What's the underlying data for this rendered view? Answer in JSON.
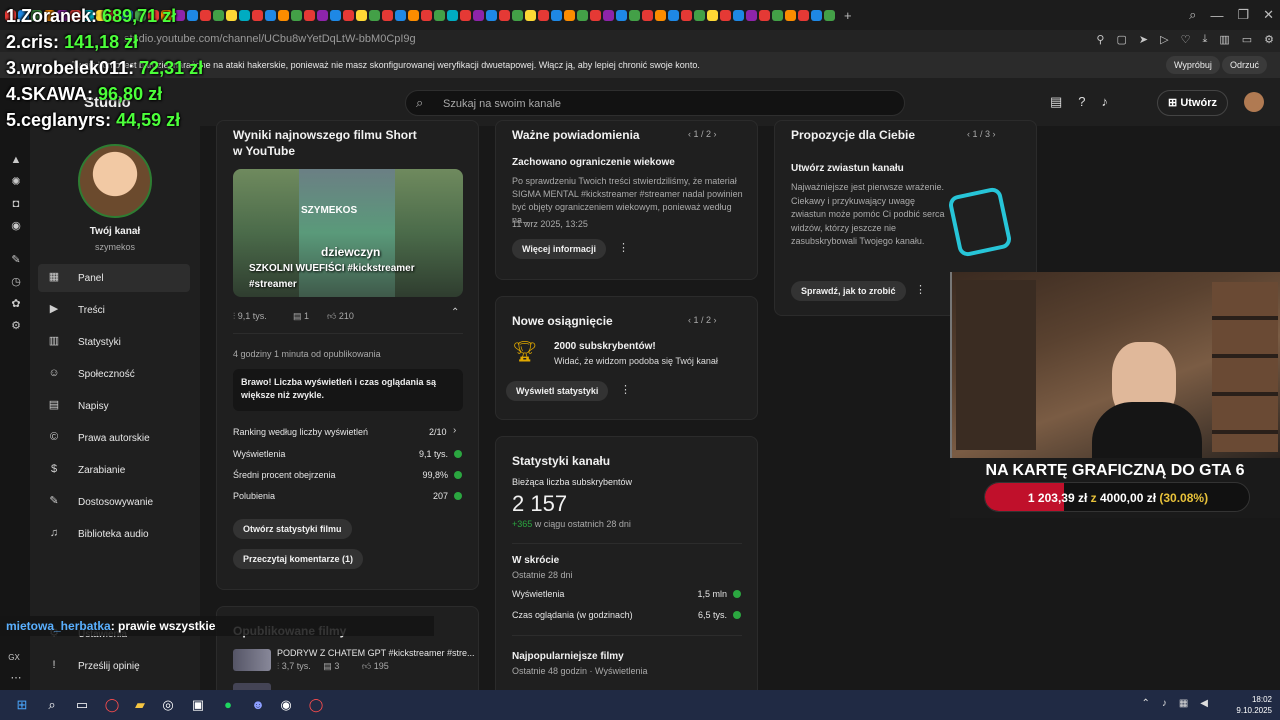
{
  "browser": {
    "url": "studio.youtube.com/channel/UCbu8wYetDqLtW-bbM0CpI9g",
    "tab_favicon_colors": [
      "#e53935",
      "#1e88e5",
      "#43a047",
      "#fb8c00",
      "#8e24aa",
      "#e53935",
      "#00acc1",
      "#fdd835",
      "#e53935",
      "#1e88e5",
      "#43a047",
      "#e53935",
      "#fb8c00",
      "#8e24aa",
      "#1e88e5",
      "#e53935",
      "#43a047",
      "#fdd835",
      "#00acc1",
      "#e53935",
      "#1e88e5",
      "#fb8c00",
      "#43a047",
      "#e53935",
      "#8e24aa",
      "#1e88e5",
      "#e53935",
      "#fdd835",
      "#43a047",
      "#e53935",
      "#1e88e5",
      "#fb8c00",
      "#e53935",
      "#43a047",
      "#00acc1",
      "#e53935",
      "#8e24aa",
      "#1e88e5",
      "#e53935",
      "#43a047",
      "#fdd835",
      "#e53935",
      "#1e88e5",
      "#fb8c00",
      "#43a047",
      "#e53935",
      "#8e24aa",
      "#1e88e5",
      "#43a047",
      "#e53935",
      "#fb8c00",
      "#1e88e5",
      "#e53935",
      "#43a047",
      "#fdd835",
      "#e53935",
      "#1e88e5",
      "#8e24aa",
      "#e53935",
      "#43a047",
      "#fb8c00",
      "#e53935",
      "#1e88e5",
      "#43a047"
    ],
    "security_warning": "Twoje konto jest bardziej narażone na ataki hakerskie, ponieważ nie masz skonfigurowanej weryfikacji dwuetapowej. Włącz ją, aby lepiej chronić swoje konto.",
    "warning_try": "Wypróbuj",
    "warning_dismiss": "Odrzuć"
  },
  "studio": {
    "logo": "Studio",
    "search_placeholder": "Szukaj na swoim kanale",
    "create_label": "Utwórz"
  },
  "sidebar": {
    "channel_name": "Twój kanał",
    "channel_handle": "szymekos",
    "items": [
      {
        "label": "Panel",
        "icon": "dashboard-icon",
        "glyph": "▦"
      },
      {
        "label": "Treści",
        "icon": "content-icon",
        "glyph": "▶"
      },
      {
        "label": "Statystyki",
        "icon": "analytics-icon",
        "glyph": "▥"
      },
      {
        "label": "Społeczność",
        "icon": "community-icon",
        "glyph": "☺"
      },
      {
        "label": "Napisy",
        "icon": "subtitles-icon",
        "glyph": "▤"
      },
      {
        "label": "Prawa autorskie",
        "icon": "copyright-icon",
        "glyph": "©"
      },
      {
        "label": "Zarabianie",
        "icon": "earn-icon",
        "glyph": "$"
      },
      {
        "label": "Dostosowywanie",
        "icon": "customize-icon",
        "glyph": "✎"
      },
      {
        "label": "Biblioteka audio",
        "icon": "audio-library-icon",
        "glyph": "♫"
      }
    ],
    "settings_label": "Ustawienia",
    "feedback_label": "Prześlij opinię"
  },
  "short_card": {
    "title_line1": "Wyniki najnowszego filmu Short",
    "title_line2": "w YouTube",
    "video_title_line1": "SZKOLNI WUEFIŚCI #kickstreamer",
    "video_title_line2": "#streamer",
    "thumb_caption": "dziewczyn",
    "thumb_brand": "SZYMEKOS",
    "views": "9,1 tys.",
    "comments": "1",
    "likes": "210",
    "published": "4 godziny 1 minuta od opublikowania",
    "notice": "Brawo! Liczba wyświetleń i czas oglądania są większe niż zwykle.",
    "ranking_label": "Ranking według liczby wyświetleń",
    "ranking_value": "2/10",
    "rows": [
      {
        "label": "Wyświetlenia",
        "value": "9,1 tys."
      },
      {
        "label": "Średni procent obejrzenia",
        "value": "99,8%"
      },
      {
        "label": "Polubienia",
        "value": "207"
      }
    ],
    "btn_stats": "Otwórz statystyki filmu",
    "btn_comments": "Przeczytaj komentarze (1)"
  },
  "published_card": {
    "title": "Opublikowane filmy",
    "item1_title": "PODRYW Z CHATEM GPT #kickstreamer #stre...",
    "item1_views": "3,7 tys.",
    "item1_comments": "3",
    "item1_likes": "195"
  },
  "notifications": {
    "title": "Ważne powiadomienia",
    "pager": "1 / 2",
    "subtitle": "Zachowano ograniczenie wiekowe",
    "body": "Po sprawdzeniu Twoich treści stwierdziliśmy, że materiał SIGMA MENTAL #kickstreamer #streamer nadal powinien być objęty ograniczeniem wiekowym, ponieważ według na...",
    "date": "11 wrz 2025, 13:25",
    "button": "Więcej informacji"
  },
  "achievement": {
    "title": "Nowe osiągnięcie",
    "pager": "1 / 2",
    "headline": "2000 subskrybentów!",
    "sub": "Widać, że widzom podoba się Twój kanał",
    "button": "Wyświetl statystyki"
  },
  "channel_stats": {
    "title": "Statystyki kanału",
    "subs_label": "Bieżąca liczba subskrybentów",
    "subs_value": "2 157",
    "subs_delta": "+365",
    "subs_delta_suffix": " w ciągu ostatnich 28 dni",
    "summary_title": "W skrócie",
    "summary_period": "Ostatnie 28 dni",
    "summary_rows": [
      {
        "label": "Wyświetlenia",
        "value": "1,5 mln"
      },
      {
        "label": "Czas oglądania (w godzinach)",
        "value": "6,5 tys."
      }
    ],
    "popular_title": "Najpopularniejsze filmy",
    "popular_sub": "Ostatnie 48 godzin · Wyświetlenia"
  },
  "suggestions": {
    "title": "Propozycje dla Ciebie",
    "pager": "1 / 3",
    "subtitle": "Utwórz zwiastun kanału",
    "body": "Najważniejsze jest pierwsze wrażenie. Ciekawy i przykuwający uwagę zwiastun może pomóc Ci podbić serca widzów, którzy jeszcze nie zasubskrybowali Twojego kanału.",
    "button": "Sprawdź, jak to zrobić"
  },
  "stream_overlay": {
    "leaderboard": [
      {
        "rank": "1.",
        "name": "Zoranek:",
        "amount": "689,71 zł"
      },
      {
        "rank": "2.",
        "name": "cris:",
        "amount": "141,18 zł"
      },
      {
        "rank": "3.",
        "name": "wrobelek011:",
        "amount": "72,31 zł"
      },
      {
        "rank": "4.",
        "name": "SKAWA:",
        "amount": "96,80 zł"
      },
      {
        "rank": "5.",
        "name": "ceglanyrs:",
        "amount": "44,59 zł"
      }
    ],
    "goal_title": "NA KARTĘ GRAFICZNĄ DO GTA 6",
    "goal_current": "1 203,39 zł",
    "goal_sep": " z ",
    "goal_target": "4000,00 zł",
    "goal_percent": "(30.08%)",
    "goal_fraction": 0.3008,
    "chat_user": "mietowa_herbatka",
    "chat_message": ": prawie wszystkie"
  },
  "taskbar": {
    "time": "18:02",
    "date": "9.10.2025"
  }
}
